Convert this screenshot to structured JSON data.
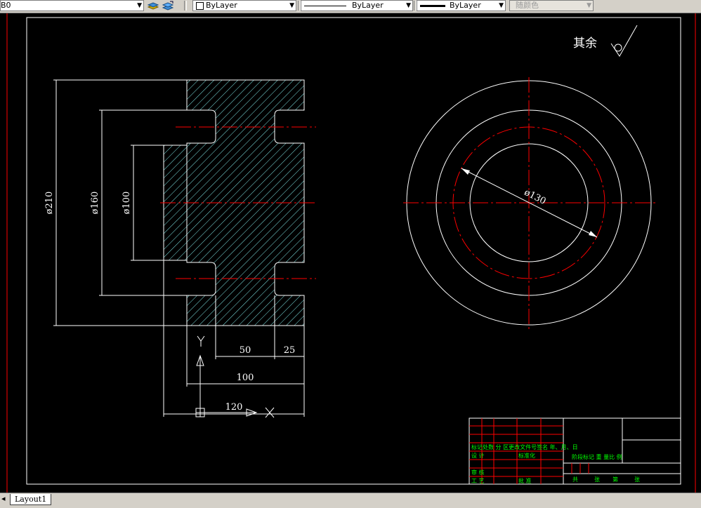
{
  "toolbar": {
    "layer_name": "B0",
    "color_combo": "ByLayer",
    "linetype_combo": "ByLayer",
    "lineweight_combo": "ByLayer",
    "plotstyle_combo": "随颜色"
  },
  "drawing": {
    "roughness_label": "其余",
    "dims": {
      "d210": "ø210",
      "d160": "ø160",
      "d100": "ø100",
      "d130": "ø130",
      "w50": "50",
      "w25": "25",
      "w100": "100",
      "w120": "120"
    },
    "ucs": {
      "x": "X",
      "y": "Y"
    },
    "title_block": {
      "header": "标记处数 分 区更改文件号签名 年、月、日",
      "design": "设 计",
      "standardize": "标准化",
      "review": "审 核",
      "process": "工 艺",
      "approve": "批 准",
      "stage": "阶段标记 重 量比 例",
      "total": "共",
      "sheets": "张",
      "page": "第",
      "sheet2": "张"
    }
  },
  "tabs": {
    "layout1": "Layout1"
  },
  "colors": {
    "background": "#000000",
    "outline": "#ffffff",
    "center": "#ff0000",
    "hatch": "#7fe5e5",
    "titletext": "#00ff00"
  }
}
